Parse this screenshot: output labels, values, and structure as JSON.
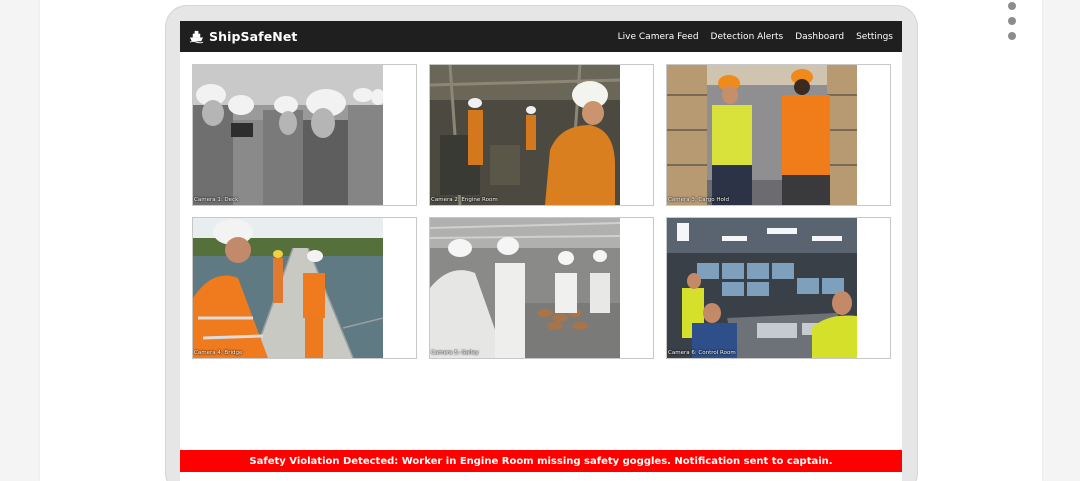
{
  "app": {
    "brand": "ShipSafeNet",
    "brand_icon": "ship-icon"
  },
  "nav": {
    "items": [
      {
        "label": "Live Camera Feed"
      },
      {
        "label": "Detection Alerts"
      },
      {
        "label": "Dashboard"
      },
      {
        "label": "Settings"
      }
    ]
  },
  "cameras": [
    {
      "label": "Camera 1: Deck",
      "scene": "workers-hardhats-grayscale"
    },
    {
      "label": "Camera 2: Engine Room",
      "scene": "engine-room-workers"
    },
    {
      "label": "Camera 3: Cargo Hold",
      "scene": "warehouse-workers-vests"
    },
    {
      "label": "Camera 4: Bridge",
      "scene": "workers-on-walkway"
    },
    {
      "label": "Camera 5: Galley",
      "scene": "kitchen-cooks"
    },
    {
      "label": "Camera 6: Control Room",
      "scene": "control-room-operators"
    }
  ],
  "alert": {
    "message": "Safety Violation Detected: Worker in Engine Room missing safety goggles. Notification sent to captain.",
    "color": "#ff0000"
  },
  "colors": {
    "navbar": "#1f1f1f",
    "accent_alert": "#ff0000"
  }
}
